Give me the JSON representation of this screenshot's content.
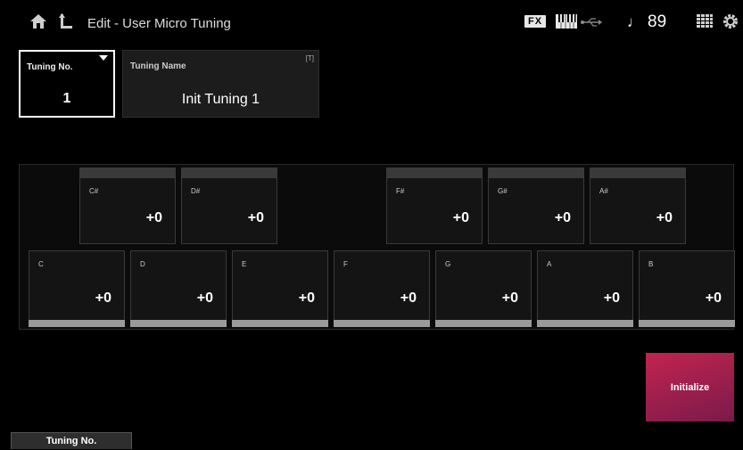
{
  "header": {
    "title": "Edit - User Micro Tuning",
    "fx": "FX",
    "tempo_symbol": "♩",
    "tempo": "89",
    "icons": [
      "home-icon",
      "back-icon",
      "keyboard-icon",
      "usb-icon",
      "grid-icon",
      "settings-icon"
    ]
  },
  "tuning_no": {
    "label": "Tuning No.",
    "value": "1"
  },
  "tuning_name": {
    "label": "Tuning Name",
    "value": "Init Tuning 1",
    "icon_text": "[T]"
  },
  "black_keys": [
    {
      "note": "C#",
      "value": "+0"
    },
    {
      "note": "D#",
      "value": "+0"
    },
    {
      "note": "F#",
      "value": "+0"
    },
    {
      "note": "G#",
      "value": "+0"
    },
    {
      "note": "A#",
      "value": "+0"
    }
  ],
  "white_keys": [
    {
      "note": "C",
      "value": "+0"
    },
    {
      "note": "D",
      "value": "+0"
    },
    {
      "note": "E",
      "value": "+0"
    },
    {
      "note": "F",
      "value": "+0"
    },
    {
      "note": "G",
      "value": "+0"
    },
    {
      "note": "A",
      "value": "+0"
    },
    {
      "note": "B",
      "value": "+0"
    }
  ],
  "initialize_label": "Initialize",
  "bottom_tab_label": "Tuning No.",
  "colors": {
    "accent": "#c22450",
    "background": "#000000",
    "selected_border": "#ffffff"
  }
}
